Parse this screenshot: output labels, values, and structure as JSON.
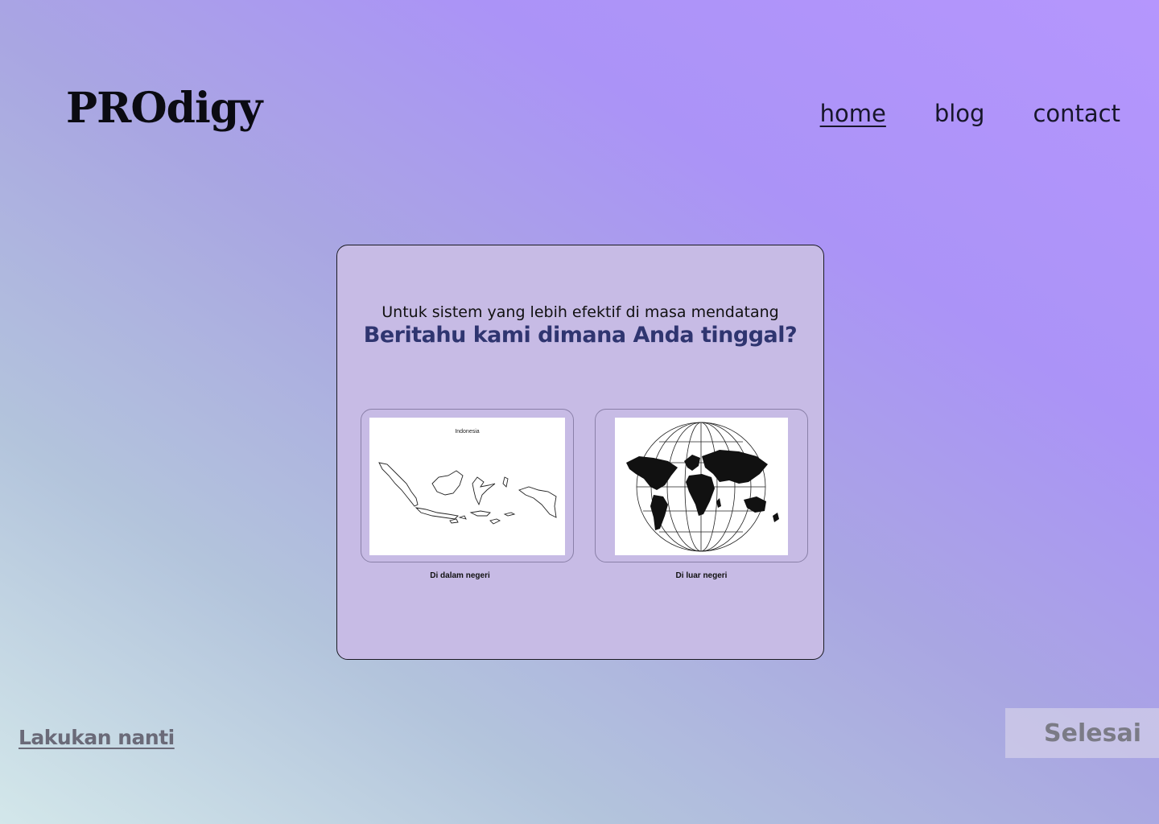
{
  "header": {
    "logo": "PROdigy",
    "nav": [
      {
        "label": "home",
        "active": true
      },
      {
        "label": "blog",
        "active": false
      },
      {
        "label": "contact",
        "active": false
      }
    ]
  },
  "card": {
    "subtitle": "Untuk sistem yang lebih efektif di masa mendatang",
    "question": "Beritahu kami dimana Anda tinggal?",
    "options": [
      {
        "image_title": "Indonesia",
        "caption": "Di dalam negeri",
        "icon": "indonesia-map"
      },
      {
        "caption": "Di luar negeri",
        "icon": "world-globe"
      }
    ]
  },
  "footer": {
    "later_label": "Lakukan nanti",
    "done_label": "Selesai"
  },
  "colors": {
    "accent_heading": "#2f3570",
    "card_bg": "#c7bbe5"
  }
}
